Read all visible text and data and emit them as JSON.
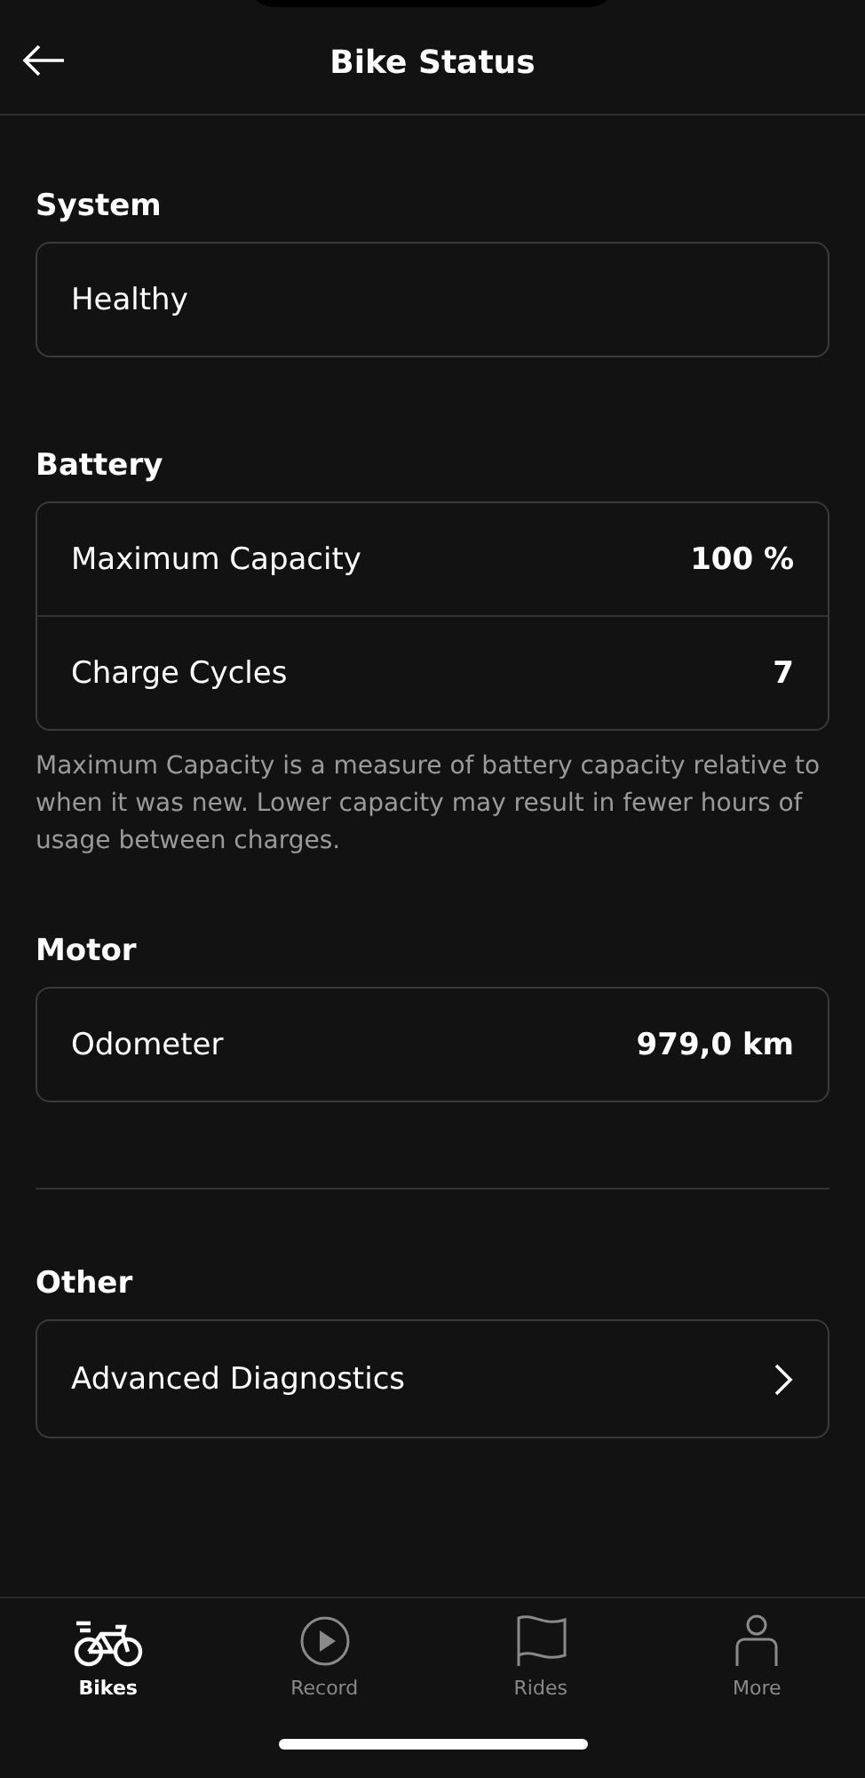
{
  "header": {
    "title": "Bike Status"
  },
  "sections": [
    {
      "title": "System",
      "rows": [
        {
          "kind": "value",
          "label": "Healthy"
        }
      ]
    },
    {
      "title": "Battery",
      "rows": [
        {
          "kind": "value",
          "label": "Maximum Capacity",
          "value": "100 %"
        },
        {
          "kind": "value",
          "label": "Charge Cycles",
          "value": "7"
        }
      ],
      "note": "Maximum Capacity is a measure of battery capacity relative to when it was new. Lower capacity may result in fewer hours of usage between charges."
    },
    {
      "title": "Motor",
      "rows": [
        {
          "kind": "value",
          "label": "Odometer",
          "value": "979,0 km"
        }
      ],
      "divider_after": true
    },
    {
      "title": "Other",
      "rows": [
        {
          "kind": "link",
          "label": "Advanced Diagnostics"
        }
      ]
    }
  ],
  "tabs": [
    {
      "kind": "bike",
      "label": "Bikes",
      "selected": true
    },
    {
      "kind": "record",
      "label": "Record",
      "selected": false
    },
    {
      "kind": "flag",
      "label": "Rides",
      "selected": false
    },
    {
      "kind": "person",
      "label": "More",
      "selected": false
    }
  ]
}
